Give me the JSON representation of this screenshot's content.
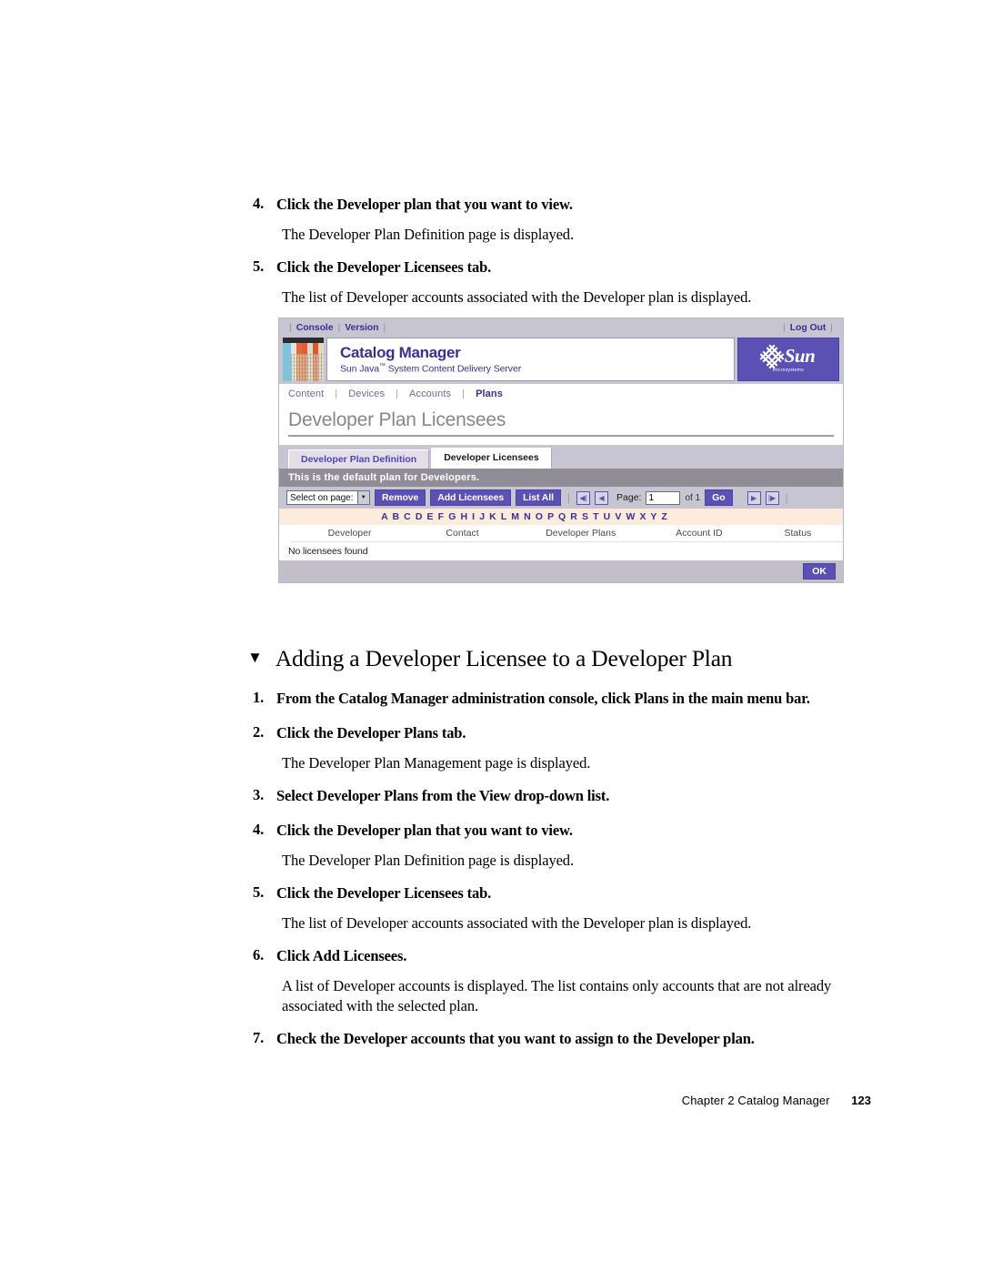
{
  "document": {
    "top_steps": [
      {
        "num": "4.",
        "bold": "Click the Developer plan that you want to view.",
        "body": "The Developer Plan Definition page is displayed."
      },
      {
        "num": "5.",
        "bold": "Click the Developer Licensees tab.",
        "body": "The list of Developer accounts associated with the Developer plan is displayed."
      }
    ],
    "section": {
      "marker": "▼",
      "title": "Adding a Developer Licensee to a Developer Plan"
    },
    "bottom_steps": [
      {
        "num": "1.",
        "bold": "From the Catalog Manager administration console, click Plans in the main menu bar.",
        "body": ""
      },
      {
        "num": "2.",
        "bold": "Click the Developer Plans tab.",
        "body": "The Developer Plan Management page is displayed."
      },
      {
        "num": "3.",
        "bold": "Select Developer Plans from the View drop-down list.",
        "body": ""
      },
      {
        "num": "4.",
        "bold": "Click the Developer plan that you want to view.",
        "body": "The Developer Plan Definition page is displayed."
      },
      {
        "num": "5.",
        "bold": "Click the Developer Licensees tab.",
        "body": "The list of Developer accounts associated with the Developer plan is displayed."
      },
      {
        "num": "6.",
        "bold": "Click Add Licensees.",
        "body": "A list of Developer accounts is displayed. The list contains only accounts that are not already associated with the selected plan."
      },
      {
        "num": "7.",
        "bold": "Check the Developer accounts that you want to assign to the Developer plan.",
        "body": ""
      }
    ],
    "footer": {
      "chapter": "Chapter 2   Catalog Manager",
      "page_number": "123"
    }
  },
  "screenshot": {
    "util_bar": {
      "left_links": [
        "Console",
        "Version"
      ],
      "right_link": "Log Out",
      "separator": "|"
    },
    "masthead": {
      "title": "Catalog Manager",
      "subtitle_pre": "Sun Java",
      "subtitle_tm": "™",
      "subtitle_post": " System Content Delivery Server",
      "logo_word": "Sun",
      "logo_tagline": "microsystems"
    },
    "main_nav": {
      "items": [
        {
          "label": "Content",
          "active": false
        },
        {
          "label": "Devices",
          "active": false
        },
        {
          "label": "Accounts",
          "active": false
        },
        {
          "label": "Plans",
          "active": true
        }
      ],
      "separator": "|"
    },
    "page_title": "Developer Plan Licensees",
    "tabs": [
      {
        "label": "Developer Plan Definition",
        "active": false
      },
      {
        "label": "Developer Licensees",
        "active": true
      }
    ],
    "message_band": "This is the default plan for Developers.",
    "toolbar": {
      "select_label": "Select on page:",
      "select_arrow": "▼",
      "remove_label": "Remove",
      "add_licensees_label": "Add Licensees",
      "list_all_label": "List All",
      "first_icon": "◀|",
      "prev_icon": "◀",
      "page_label": "Page:",
      "page_value": "1",
      "of_label": "of 1",
      "go_label": "Go",
      "next_icon": "▶",
      "last_icon": "|▶",
      "separator": "|"
    },
    "alpha_index": "A B C D E F G H I J K L M N O P Q R S T U V W X Y Z",
    "table": {
      "headers": [
        "Developer",
        "Contact",
        "Developer Plans",
        "Account ID",
        "Status"
      ],
      "empty_message": "No licensees found"
    },
    "footer_band": {
      "ok_label": "OK"
    },
    "colors": {
      "accent_purple": "#5b51b5",
      "chrome_lavender": "#c8c5d2",
      "band_grey": "#908d96",
      "alpha_peach": "#fdecdc",
      "link_purple": "#3c2f8f"
    }
  }
}
